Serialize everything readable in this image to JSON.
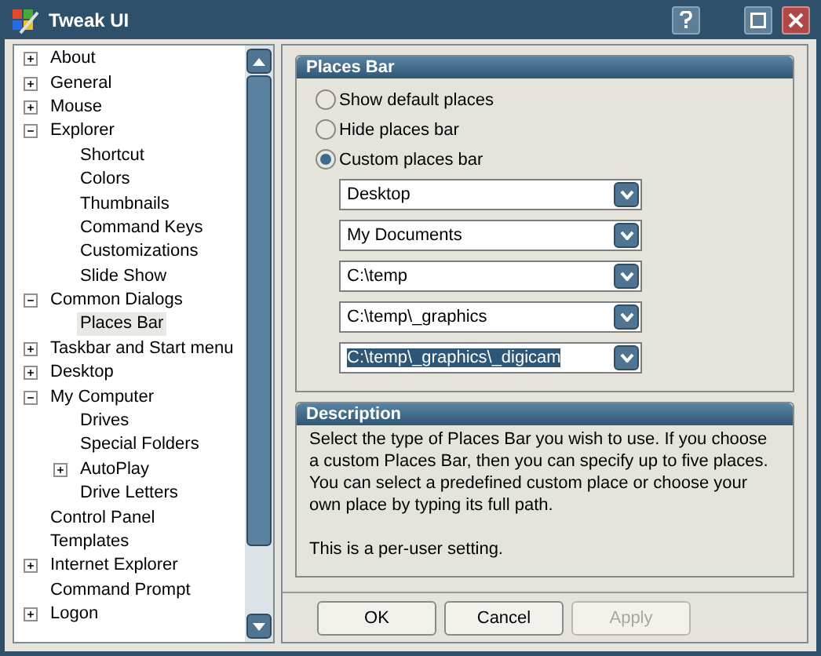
{
  "window": {
    "title": "Tweak UI"
  },
  "tree": [
    {
      "label": "About",
      "expanded": false,
      "selected": false
    },
    {
      "label": "General",
      "expanded": false,
      "selected": false
    },
    {
      "label": "Mouse",
      "expanded": false,
      "selected": false
    },
    {
      "label": "Explorer",
      "expanded": true,
      "selected": false,
      "children": [
        {
          "label": "Shortcut",
          "selected": false
        },
        {
          "label": "Colors",
          "selected": false
        },
        {
          "label": "Thumbnails",
          "selected": false
        },
        {
          "label": "Command Keys",
          "selected": false
        },
        {
          "label": "Customizations",
          "selected": false
        },
        {
          "label": "Slide Show",
          "selected": false
        }
      ]
    },
    {
      "label": "Common Dialogs",
      "expanded": true,
      "selected": false,
      "children": [
        {
          "label": "Places Bar",
          "selected": true
        }
      ]
    },
    {
      "label": "Taskbar and Start menu",
      "expanded": false,
      "selected": false
    },
    {
      "label": "Desktop",
      "expanded": false,
      "selected": false
    },
    {
      "label": "My Computer",
      "expanded": true,
      "selected": false,
      "children": [
        {
          "label": "Drives",
          "selected": false
        },
        {
          "label": "Special Folders",
          "selected": false
        },
        {
          "label": "AutoPlay",
          "expanded": false,
          "selected": false
        },
        {
          "label": "Drive Letters",
          "selected": false
        }
      ]
    },
    {
      "label": "Control Panel",
      "selected": false
    },
    {
      "label": "Templates",
      "selected": false
    },
    {
      "label": "Internet Explorer",
      "expanded": false,
      "selected": false
    },
    {
      "label": "Command Prompt",
      "selected": false
    },
    {
      "label": "Logon",
      "expanded": false,
      "selected": false
    }
  ],
  "places_bar": {
    "title": "Places Bar",
    "options": [
      {
        "label": "Show default places",
        "selected": false
      },
      {
        "label": "Hide places bar",
        "selected": false
      },
      {
        "label": "Custom places bar",
        "selected": true
      }
    ],
    "places": [
      {
        "value": "Desktop",
        "selected": false
      },
      {
        "value": "My Documents",
        "selected": false
      },
      {
        "value": "C:\\temp",
        "selected": false
      },
      {
        "value": "C:\\temp\\_graphics",
        "selected": false
      },
      {
        "value": "C:\\temp\\_graphics\\_digicam",
        "selected": true
      }
    ]
  },
  "description": {
    "title": "Description",
    "paragraphs": [
      "Select the type of Places Bar you wish to use.  If you choose a custom Places Bar, then you can specify up to five places. You can select a predefined custom place or choose your own place by typing its full path.",
      "This is a per-user setting."
    ]
  },
  "buttons": [
    {
      "label": "OK",
      "disabled": false
    },
    {
      "label": "Cancel",
      "disabled": false
    },
    {
      "label": "Apply",
      "disabled": true
    }
  ]
}
